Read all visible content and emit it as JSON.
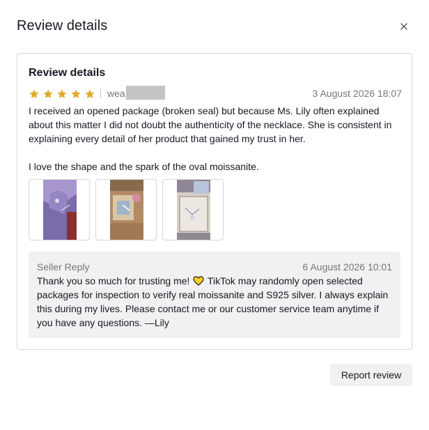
{
  "dialog": {
    "title": "Review details",
    "close_icon": "close-icon"
  },
  "review": {
    "section_title": "Review details",
    "rating": 5,
    "max_rating": 5,
    "star_color": "#e0a928",
    "username": "wea",
    "timestamp": "3 August 2026 18:07",
    "paragraph_1": "I received an opened package (broken seal) but because Ms. Lily often explained about this matter I did not doubt the authenticity of the necklace. She is consistent in explaining every detail of her product that gained my trust in her.",
    "paragraph_2": "I love the shape and the spark of the oval moissanite.",
    "images": [
      {
        "name": "review-image-1"
      },
      {
        "name": "review-image-2"
      },
      {
        "name": "review-image-3"
      }
    ]
  },
  "seller_reply": {
    "label": "Seller Reply",
    "timestamp": "6 August 2026 10:01",
    "text_before_emoji": "Thank you so much for trusting me! ",
    "emoji": "yellow-heart-icon",
    "text_after_emoji": " TikTok may randomly open selected packages for inspection to verify real moissanite and S925 silver. I always explain this during my lives. Please contact me or our customer service team anytime if you have any questions. —Lily"
  },
  "actions": {
    "report_label": "Report review"
  }
}
